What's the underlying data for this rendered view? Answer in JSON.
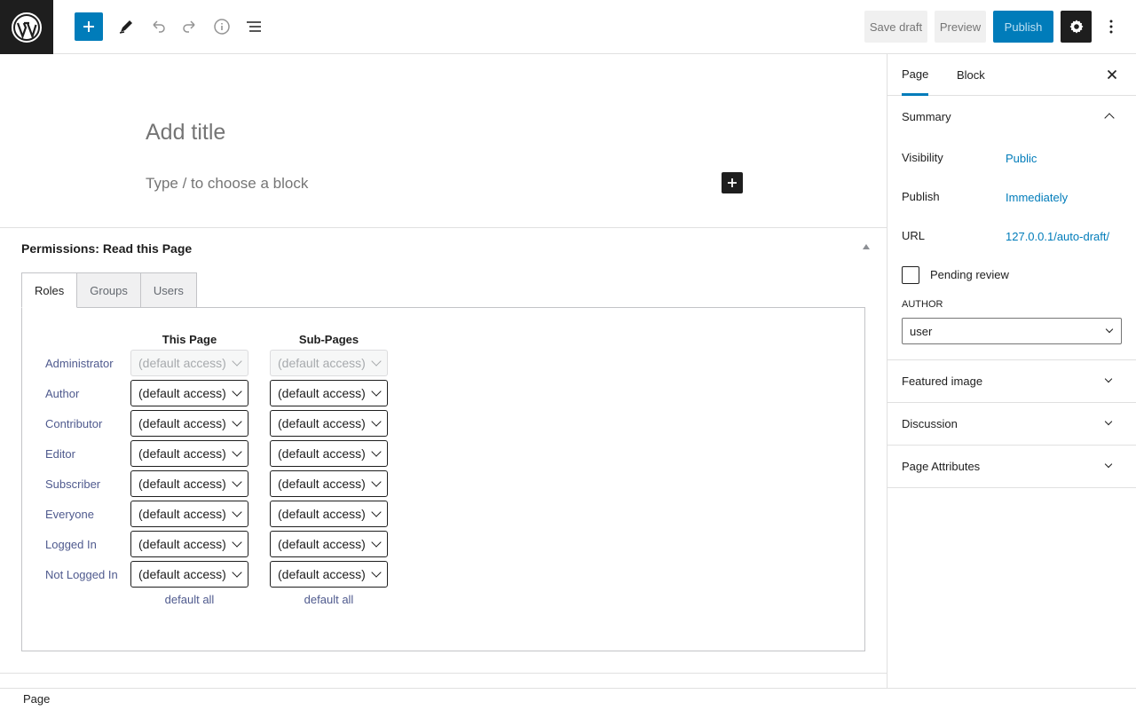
{
  "toolbar": {
    "save_draft": "Save draft",
    "preview": "Preview",
    "publish": "Publish"
  },
  "editor": {
    "title_placeholder": "Add title",
    "block_placeholder": "Type / to choose a block"
  },
  "metabox": {
    "title": "Permissions: Read this Page",
    "tabs": [
      "Roles",
      "Groups",
      "Users"
    ],
    "active_tab": "Roles",
    "columns": [
      "This Page",
      "Sub-Pages"
    ],
    "roles": [
      {
        "name": "Administrator",
        "this_page": "(default access)",
        "sub_pages": "(default access)",
        "disabled": true
      },
      {
        "name": "Author",
        "this_page": "(default access)",
        "sub_pages": "(default access)",
        "disabled": false
      },
      {
        "name": "Contributor",
        "this_page": "(default access)",
        "sub_pages": "(default access)",
        "disabled": false
      },
      {
        "name": "Editor",
        "this_page": "(default access)",
        "sub_pages": "(default access)",
        "disabled": false
      },
      {
        "name": "Subscriber",
        "this_page": "(default access)",
        "sub_pages": "(default access)",
        "disabled": false
      },
      {
        "name": "Everyone",
        "this_page": "(default access)",
        "sub_pages": "(default access)",
        "disabled": false
      },
      {
        "name": "Logged In",
        "this_page": "(default access)",
        "sub_pages": "(default access)",
        "disabled": false
      },
      {
        "name": "Not Logged In",
        "this_page": "(default access)",
        "sub_pages": "(default access)",
        "disabled": false
      }
    ],
    "default_all_label": "default all"
  },
  "sidebar": {
    "tabs": [
      "Page",
      "Block"
    ],
    "active_tab": "Page",
    "summary": {
      "title": "Summary",
      "visibility_label": "Visibility",
      "visibility_value": "Public",
      "publish_label": "Publish",
      "publish_value": "Immediately",
      "url_label": "URL",
      "url_value": "127.0.0.1/auto-draft/",
      "pending_review": "Pending review",
      "author_label": "AUTHOR",
      "author_value": "user"
    },
    "panels": [
      "Featured image",
      "Discussion",
      "Page Attributes"
    ]
  },
  "footer": {
    "breadcrumb": "Page"
  },
  "colors": {
    "accent": "#007cba",
    "dark": "#1e1e1e",
    "link_muted": "#4f5a8e"
  }
}
